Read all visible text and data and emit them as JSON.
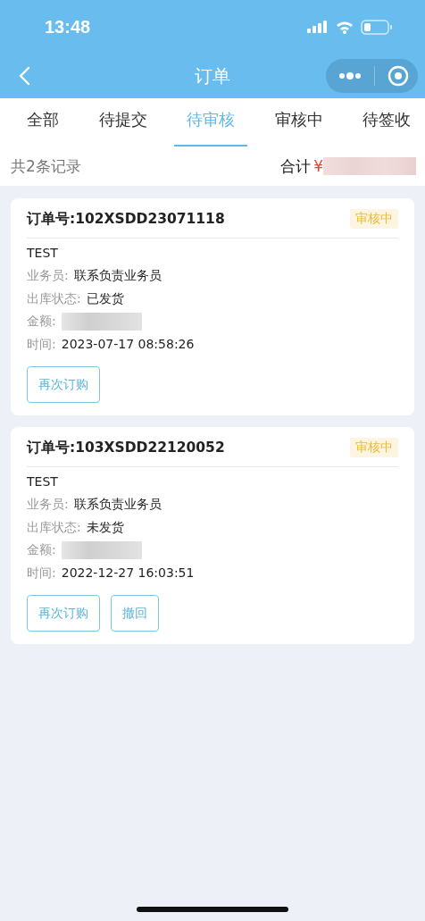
{
  "status_bar": {
    "time": "13:48"
  },
  "nav": {
    "title": "订单"
  },
  "tabs": [
    {
      "label": "全部",
      "selected": false
    },
    {
      "label": "待提交",
      "selected": false
    },
    {
      "label": "待审核",
      "selected": true
    },
    {
      "label": "审核中",
      "selected": false
    },
    {
      "label": "待签收",
      "selected": false
    }
  ],
  "summary": {
    "count": "共2条记录",
    "total_label": "合计",
    "currency": "¥",
    "total_redacted": true
  },
  "orders": [
    {
      "number": "订单号:102XSDD23071118",
      "status": "审核中",
      "customer": "TEST",
      "fields": [
        {
          "label": "业务员:",
          "kind": "text",
          "value": "联系负责业务员"
        },
        {
          "label": "出库状态:",
          "kind": "text",
          "value": "已发货"
        },
        {
          "label": "金额:",
          "kind": "redacted"
        },
        {
          "label": "时间:",
          "kind": "text",
          "value": "2023-07-17 08:58:26"
        }
      ],
      "actions": [
        "再次订购"
      ]
    },
    {
      "number": "订单号:103XSDD22120052",
      "status": "审核中",
      "customer": "TEST",
      "fields": [
        {
          "label": "业务员:",
          "kind": "text",
          "value": "联系负责业务员"
        },
        {
          "label": "出库状态:",
          "kind": "text",
          "value": "未发货"
        },
        {
          "label": "金额:",
          "kind": "redacted"
        },
        {
          "label": "时间:",
          "kind": "text",
          "value": "2022-12-27 16:03:51"
        }
      ],
      "actions": [
        "再次订购",
        "撤回"
      ]
    }
  ]
}
